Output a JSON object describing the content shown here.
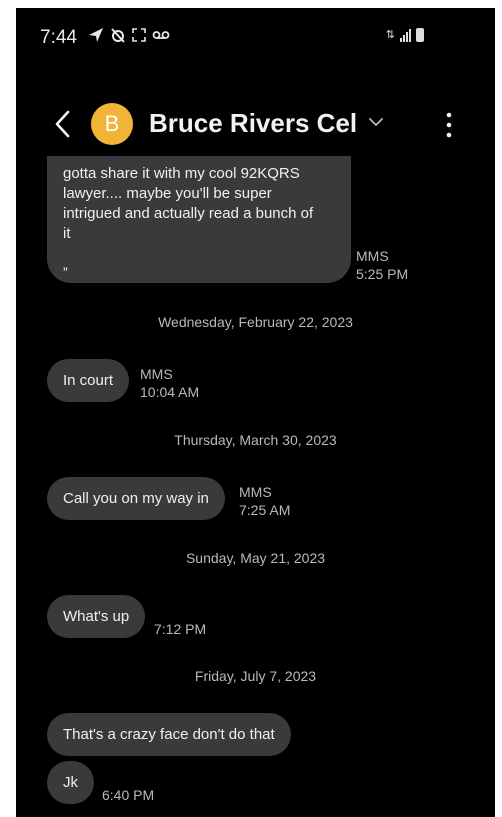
{
  "status_bar": {
    "time": "7:44",
    "left_icons": [
      "navigation-arrow-icon",
      "alarm-off-icon",
      "screenshot-frame-icon",
      "voicemail-icon"
    ],
    "right_icons": [
      "data-transfer-icon",
      "signal-icon",
      "battery-icon"
    ]
  },
  "header": {
    "avatar_initial": "B",
    "avatar_color": "#f2b438",
    "contact_name": "Bruce Rivers Cel"
  },
  "messages": [
    {
      "lines": [
        "gotta share it with my cool 92KQRS",
        "lawyer.... maybe you'll be super",
        "intrigued and actually read a bunch of",
        "it"
      ],
      "quote": "„",
      "type": "MMS",
      "time": "5:25 PM"
    },
    {
      "date": "Wednesday, February 22, 2023"
    },
    {
      "text": "In court",
      "type": "MMS",
      "time": "10:04 AM"
    },
    {
      "date": "Thursday, March 30, 2023"
    },
    {
      "text": "Call you on my way in",
      "type": "MMS",
      "time": "7:25 AM"
    },
    {
      "date": "Sunday, May 21, 2023"
    },
    {
      "text": "What's up",
      "time": "7:12 PM"
    },
    {
      "date": "Friday, July 7, 2023"
    },
    {
      "text": "That's a crazy face don't do that"
    },
    {
      "text": "Jk",
      "time": "6:40 PM"
    }
  ],
  "colors": {
    "background": "#000000",
    "bubble": "#3a3a3a",
    "text": "#f0f0f0",
    "meta": "#b9b9b9"
  }
}
